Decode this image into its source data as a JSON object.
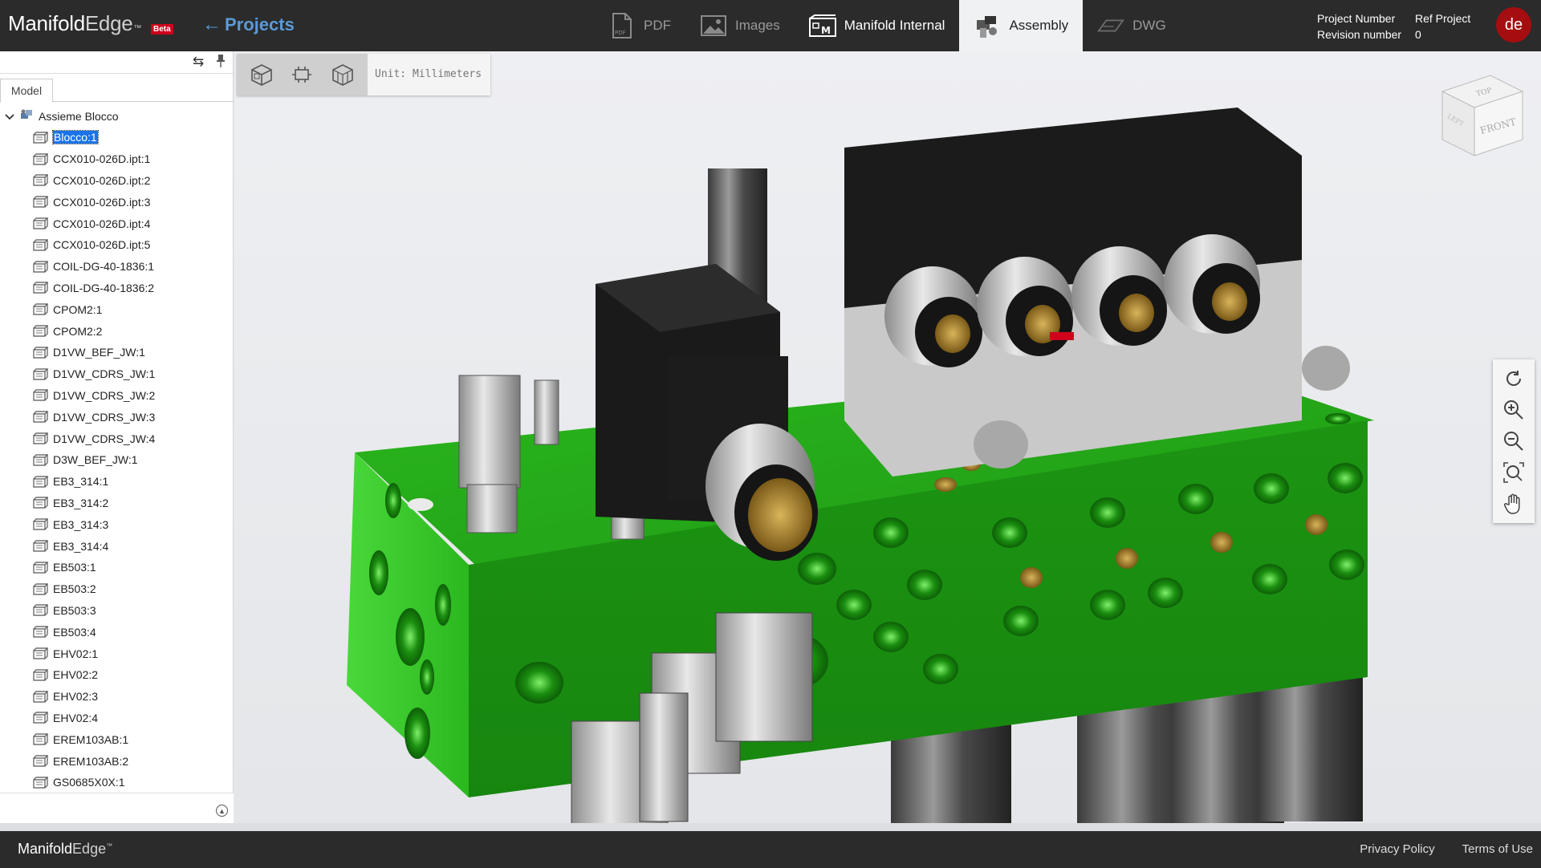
{
  "header": {
    "logo_part1": "Manifold",
    "logo_part2": "Edge",
    "logo_tm": "™",
    "beta_badge": "Beta",
    "projects_link": "Projects",
    "tabs": [
      {
        "label": "PDF",
        "icon": "pdf-icon"
      },
      {
        "label": "Images",
        "icon": "images-icon"
      },
      {
        "label": "Manifold Internal",
        "icon": "manifold-internal-icon"
      },
      {
        "label": "Assembly",
        "icon": "assembly-icon"
      },
      {
        "label": "DWG",
        "icon": "dwg-icon"
      }
    ],
    "selected_tab": "Assembly",
    "project_number_label": "Project Number",
    "revision_number_label": "Revision number",
    "project_number_value": "Ref Project",
    "revision_number_value": "0",
    "user_initials": "de"
  },
  "left_panel": {
    "model_tab": "Model",
    "root_label": "Assieme Blocco",
    "items": [
      "Blocco:1",
      "CCX010-026D.ipt:1",
      "CCX010-026D.ipt:2",
      "CCX010-026D.ipt:3",
      "CCX010-026D.ipt:4",
      "CCX010-026D.ipt:5",
      "COIL-DG-40-1836:1",
      "COIL-DG-40-1836:2",
      "CPOM2:1",
      "CPOM2:2",
      "D1VW_BEF_JW:1",
      "D1VW_CDRS_JW:1",
      "D1VW_CDRS_JW:2",
      "D1VW_CDRS_JW:3",
      "D1VW_CDRS_JW:4",
      "D3W_BEF_JW:1",
      "EB3_314:1",
      "EB3_314:2",
      "EB3_314:3",
      "EB3_314:4",
      "EB503:1",
      "EB503:2",
      "EB503:3",
      "EB503:4",
      "EHV02:1",
      "EHV02:2",
      "EHV02:3",
      "EHV02:4",
      "EREM103AB:1",
      "EREM103AB:2",
      "GS0685X0X:1"
    ],
    "selected_item": "Blocco:1"
  },
  "viewport": {
    "unit_label": "Unit: Millimeters",
    "toolbar_tools": [
      "iso-view-icon",
      "fit-part-icon",
      "section-view-icon"
    ],
    "nav_cube": {
      "top": "TOP",
      "front": "FRONT",
      "left": "LEFT"
    },
    "right_tools": [
      "rotate-icon",
      "zoom-in-icon",
      "zoom-out-icon",
      "zoom-fit-icon",
      "pan-hand-icon"
    ],
    "colors": {
      "block": "#1f9e14",
      "valve_dark": "#1c1c1c",
      "metal": "#b8b8b8"
    }
  },
  "footer": {
    "logo_part1": "Manifold",
    "logo_part2": "Edge",
    "logo_tm": "™",
    "privacy": "Privacy Policy",
    "terms": "Terms of Use"
  }
}
